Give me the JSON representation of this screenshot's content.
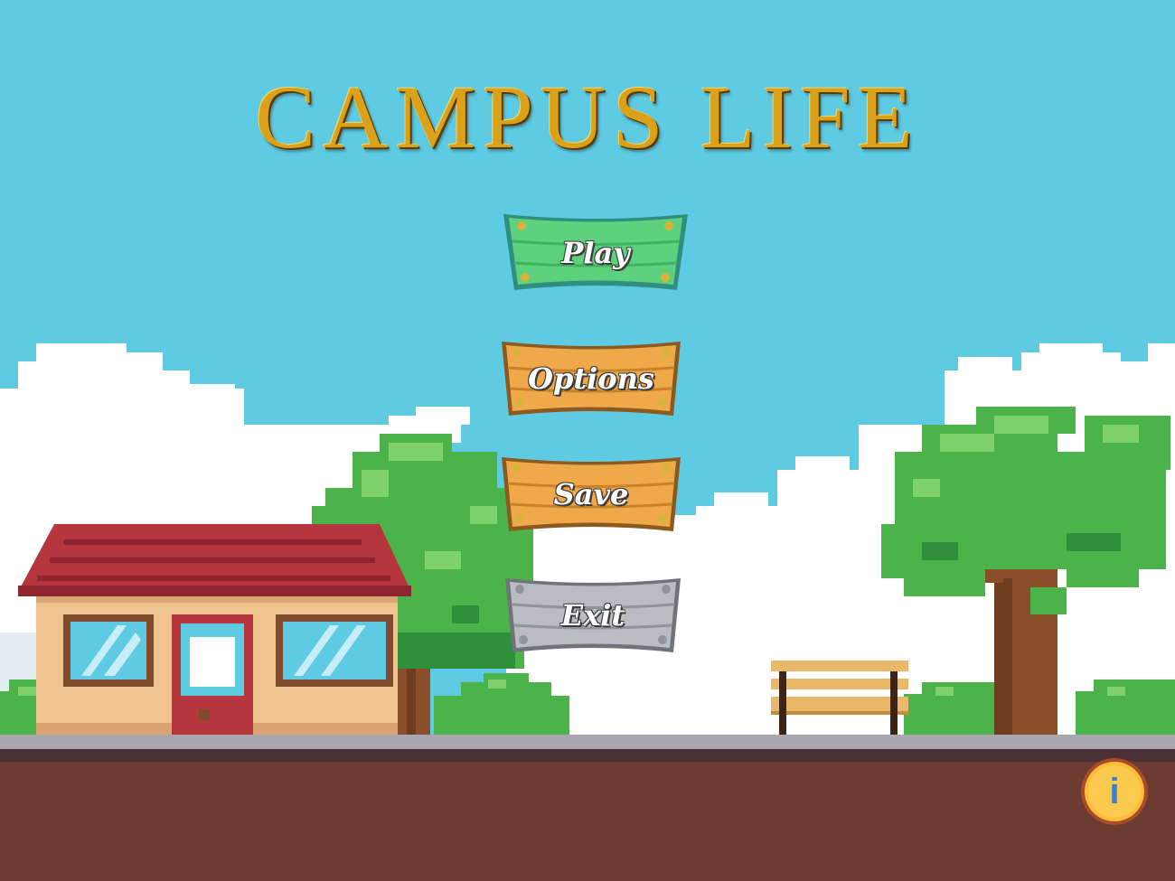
{
  "game": {
    "title": "CAMPUS LIFE"
  },
  "menu": {
    "play_label": "Play",
    "options_label": "Options",
    "save_label": "Save",
    "exit_label": "Exit"
  },
  "info": {
    "icon": "info-icon",
    "glyph": "i"
  },
  "colors": {
    "sky": "#5ecbe3",
    "play_button": "#5ed17e",
    "options_button": "#f0a94a",
    "save_button": "#f0a94a",
    "exit_button": "#b9bcc2",
    "ground": "#6a3b30",
    "title_gold": "#d9a21a",
    "info_button": "#fbbd38"
  }
}
